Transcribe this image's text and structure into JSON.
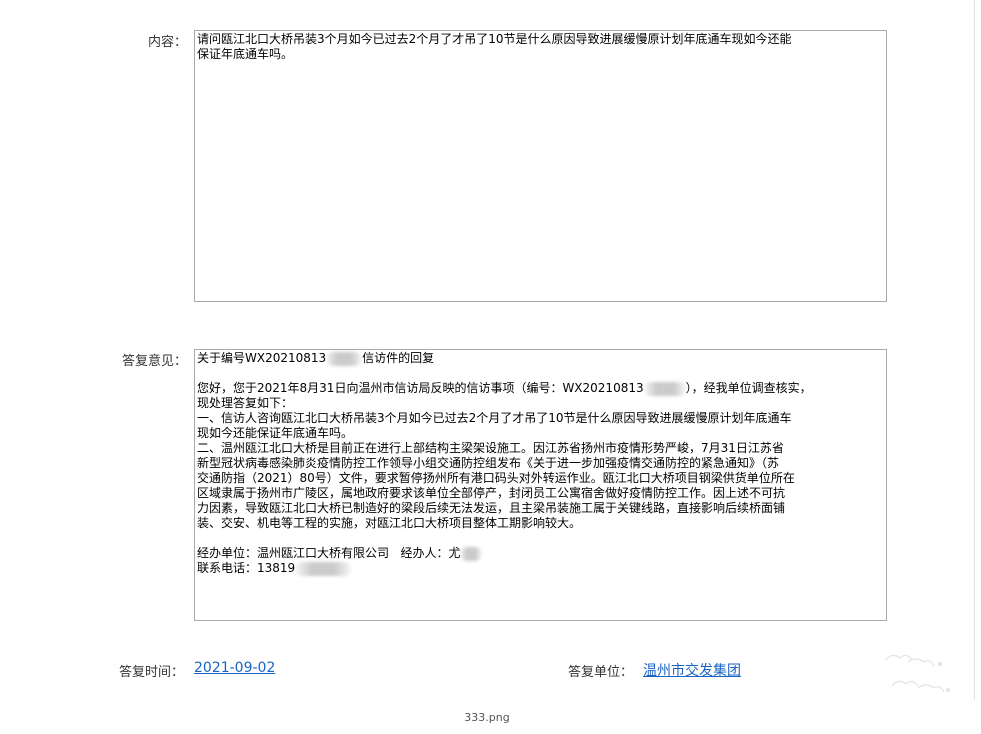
{
  "content_section": {
    "label": "内容：",
    "text_lines": [
      "请问瓯江北口大桥吊装3个月如今已过去2个月了才吊了10节是什么原因导致进展缓慢原计划年底通车现如今还能",
      "保证年底通车吗。"
    ]
  },
  "reply_section": {
    "label": "答复意见：",
    "title_prefix": "关于编号WX20210813",
    "title_suffix": "信访件的回复",
    "greeting_prefix": "您好，您于2021年8月31日向温州市信访局反映的信访事项（编号：WX20210813",
    "greeting_suffix": "），经我单位调查核实，",
    "greeting_line2": "现处理答复如下：",
    "point1_lines": [
      "一、信访人咨询瓯江北口大桥吊装3个月如今已过去2个月了才吊了10节是什么原因导致进展缓慢原计划年底通车",
      "现如今还能保证年底通车吗。"
    ],
    "point2_lines": [
      "二、温州瓯江北口大桥是目前正在进行上部结构主梁架设施工。因江苏省扬州市疫情形势严峻，7月31日江苏省",
      "新型冠状病毒感染肺炎疫情防控工作领导小组交通防控组发布《关于进一步加强疫情交通防控的紧急通知》（苏",
      "交通防指（2021）80号）文件，要求暂停扬州所有港口码头对外转运作业。瓯江北口大桥项目钢梁供货单位所在",
      "区域隶属于扬州市广陵区，属地政府要求该单位全部停产，封闭员工公寓宿舍做好疫情防控工作。因上述不可抗",
      "力因素，导致瓯江北口大桥已制造好的梁段后续无法发运，且主梁吊装施工属于关键线路，直接影响后续桥面铺",
      "装、交安、机电等工程的实施，对瓯江北口大桥项目整体工期影响较大。"
    ],
    "handler_unit_line": "经办单位：温州瓯江口大桥有限公司   经办人：尤",
    "phone_line": "联系电话：13819"
  },
  "meta": {
    "reply_time_label": "答复时间：",
    "reply_time_value": "2021-09-02",
    "reply_unit_label": "答复单位：",
    "reply_unit_value": "温州市交发集团"
  },
  "footer": {
    "filename": "333.png"
  },
  "colors": {
    "link": "#1a63c4",
    "border": "#a9a9a9",
    "label_text": "#333333"
  }
}
